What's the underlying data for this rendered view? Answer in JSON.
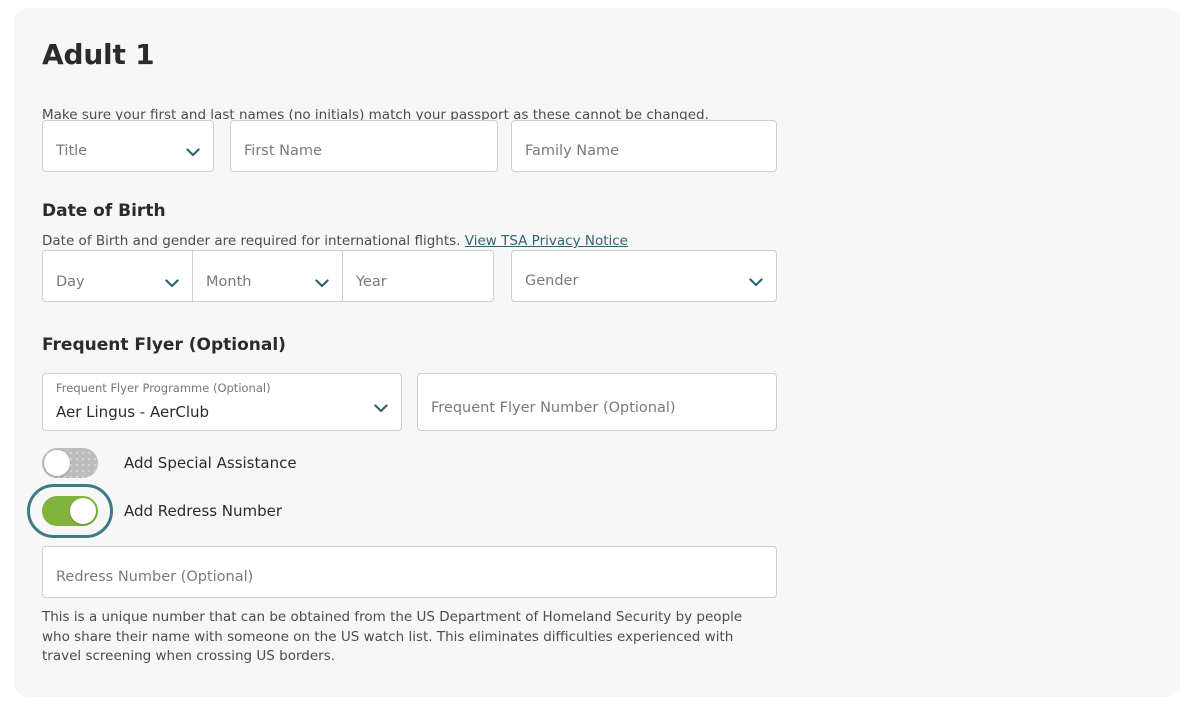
{
  "card": {
    "title": "Adult 1",
    "subtitle": "Make sure your first and last names (no initials) match your passport as these cannot be changed."
  },
  "name_fields": {
    "title_select": {
      "placeholder": "Title",
      "value": ""
    },
    "first_name": {
      "placeholder": "First Name",
      "value": ""
    },
    "family_name": {
      "placeholder": "Family Name",
      "value": ""
    }
  },
  "date_of_birth": {
    "heading": "Date of Birth",
    "description": "Date of Birth and gender are required for international flights.",
    "link_text": "View TSA Privacy Notice",
    "day": {
      "placeholder": "Day",
      "value": ""
    },
    "month": {
      "placeholder": "Month",
      "value": ""
    },
    "year": {
      "placeholder": "Year",
      "value": ""
    },
    "gender": {
      "placeholder": "Gender",
      "value": ""
    }
  },
  "frequent_flyer": {
    "heading": "Frequent Flyer (Optional)",
    "programme": {
      "label": "Frequent Flyer Programme (Optional)",
      "value": "Aer Lingus - AerClub"
    },
    "number": {
      "placeholder": "Frequent Flyer Number (Optional)",
      "value": ""
    }
  },
  "toggles": {
    "special_assistance": {
      "label": "Add Special Assistance",
      "state": "off"
    },
    "redress_number": {
      "label": "Add Redress Number",
      "state": "on",
      "focused": true
    }
  },
  "redress": {
    "input": {
      "placeholder": "Redress Number (Optional)",
      "value": ""
    },
    "helper": "This is a unique number that can be obtained from the US Department of Homeland Security by people who share their name with someone on the US watch list. This eliminates difficulties experienced with travel screening when crossing US borders."
  },
  "colors": {
    "accent_teal": "#2d6570",
    "toggle_on_green": "#82b33c",
    "focus_ring": "#3e7b85",
    "card_bg": "#f7f7f7",
    "field_border": "#cfcfcf"
  },
  "icons": {
    "chevron_down": "chevron-down-icon"
  }
}
